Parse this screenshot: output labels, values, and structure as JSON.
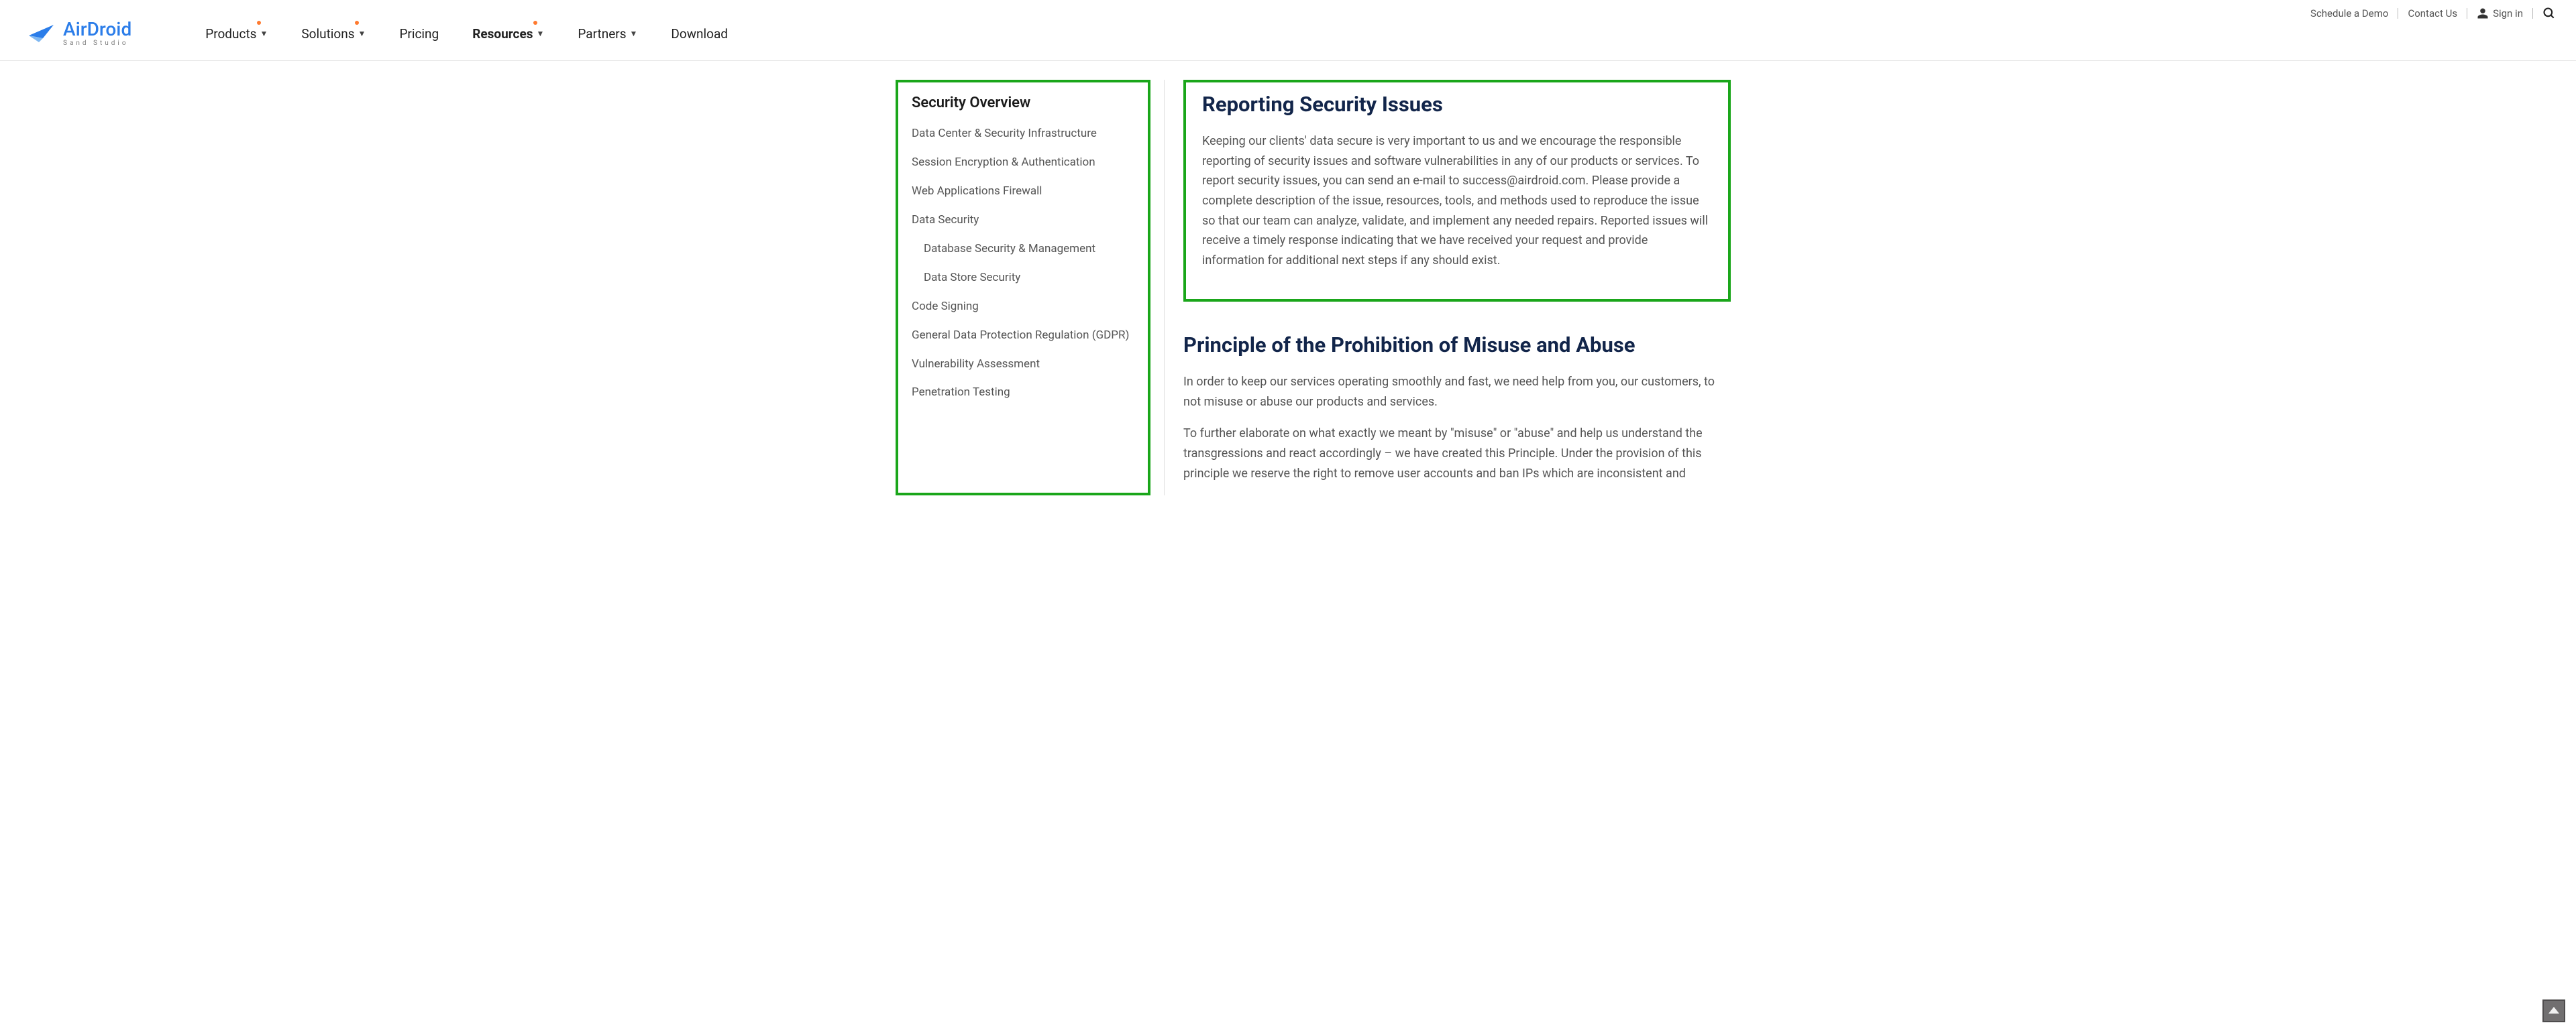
{
  "topbar": {
    "schedule": "Schedule a Demo",
    "contact": "Contact Us",
    "signin": "Sign in"
  },
  "logo": {
    "brand": "AirDroid",
    "sub": "Sand Studio"
  },
  "nav": {
    "products": "Products",
    "solutions": "Solutions",
    "pricing": "Pricing",
    "resources": "Resources",
    "partners": "Partners",
    "download": "Download"
  },
  "sidebar": {
    "title": "Security Overview",
    "items": [
      "Data Center & Security Infrastructure",
      "Session Encryption & Authentication",
      "Web Applications Firewall",
      "Data Security",
      "Database Security & Management",
      "Data Store Security",
      "Code Signing",
      "General Data Protection Regulation (GDPR)",
      "Vulnerability Assessment",
      "Penetration Testing"
    ]
  },
  "content": {
    "section1": {
      "title": "Reporting Security Issues",
      "body": "Keeping our clients' data secure is very important to us and we encourage the responsible reporting of security issues and software vulnerabilities in any of our products or services. To report security issues, you can send an e-mail to success@airdroid.com. Please provide a complete description of the issue, resources, tools, and methods used to reproduce the issue so that our team can analyze, validate, and implement any needed repairs. Reported issues will receive a timely response indicating that we have received your request and provide information for additional next steps if any should exist."
    },
    "section2": {
      "title": "Principle of the Prohibition of Misuse and Abuse",
      "p1": "In order to keep our services operating smoothly and fast, we need help from you, our customers, to not misuse or abuse our products and services.",
      "p2": "To further elaborate on what exactly we meant by \"misuse\" or \"abuse\" and help us understand the transgressions and react accordingly – we have created this Principle. Under the provision of this principle we reserve the right to remove user accounts and ban IPs which are inconsistent and"
    }
  }
}
